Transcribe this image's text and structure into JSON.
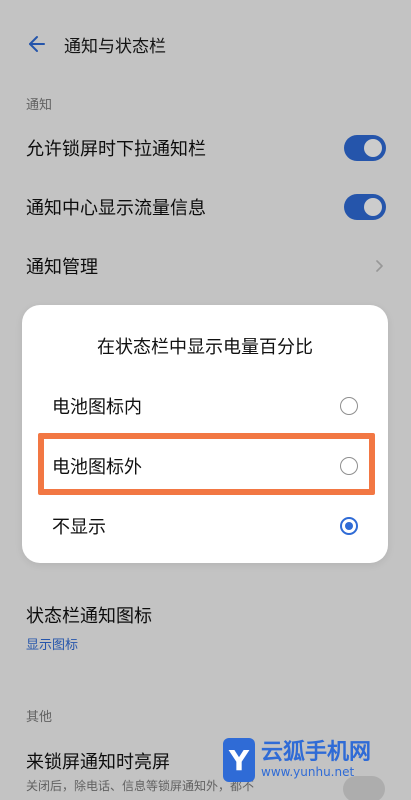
{
  "header": {
    "title": "通知与状态栏"
  },
  "section_notifications": {
    "label": "通知",
    "items": [
      {
        "label": "允许锁屏时下拉通知栏",
        "toggle": true
      },
      {
        "label": "通知中心显示流量信息",
        "toggle": true
      },
      {
        "label": "通知管理"
      }
    ]
  },
  "dialog": {
    "title": "在状态栏中显示电量百分比",
    "options": [
      {
        "label": "电池图标内",
        "selected": false
      },
      {
        "label": "电池图标外",
        "selected": false
      },
      {
        "label": "不显示",
        "selected": true
      }
    ]
  },
  "status_bar_icon": {
    "title": "状态栏通知图标",
    "value": "显示图标"
  },
  "section_other": {
    "label": "其他",
    "item": {
      "title": "来锁屏通知时亮屏",
      "desc": "关闭后，除电话、信息等锁屏通知外，都不"
    }
  },
  "watermark": {
    "logo": "Y",
    "cn": "云狐手机网",
    "url": "www.yunhu.net"
  },
  "colors": {
    "accent": "#2f6bd6",
    "highlight": "#f27743"
  }
}
